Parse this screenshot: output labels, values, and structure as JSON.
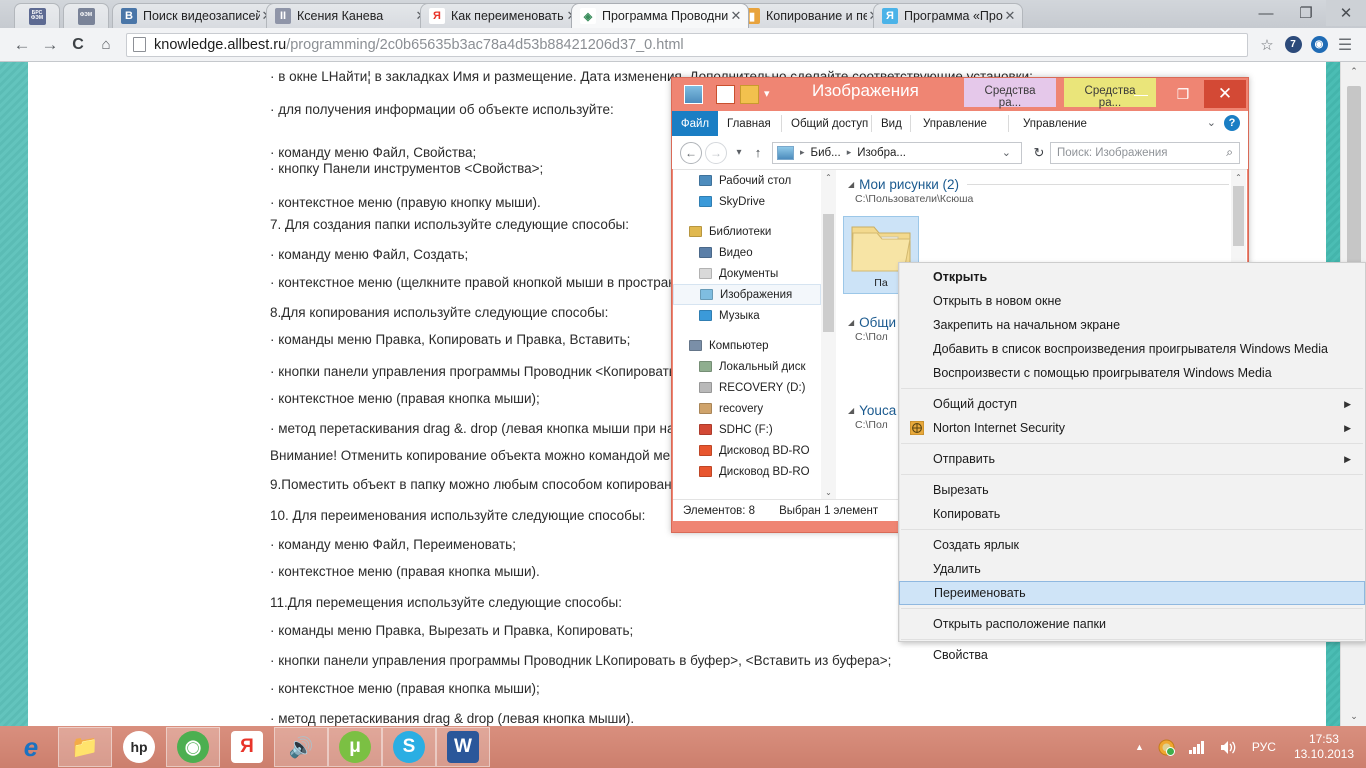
{
  "browser": {
    "pinned_tabs": [
      {
        "name": "pinned-tab-brs",
        "label": "БРС ФЭМ",
        "color": "#5d6a92"
      },
      {
        "name": "pinned-tab-fem",
        "label": "ФЭМ",
        "color": "#7a8398"
      }
    ],
    "tabs": [
      {
        "title": "Поиск видеозаписей по",
        "favicon": "vk-icon",
        "fav_letter": "B",
        "fav_color": "#4a76a8",
        "active": false,
        "close": "✕"
      },
      {
        "title": "Ксения Канева",
        "favicon": "vk-messages-icon",
        "fav_letter": "II",
        "fav_color": "#8f95a8",
        "active": false,
        "close": "✕"
      },
      {
        "title": "Как переименовать объ",
        "favicon": "yandex-icon",
        "fav_letter": "Я",
        "fav_color": "#ffffff",
        "active": false,
        "close": "✕"
      },
      {
        "title": "Программа Проводник",
        "favicon": "allbest-icon",
        "fav_letter": "◈",
        "fav_color": "#ffffff",
        "active": true,
        "close": "✕"
      },
      {
        "title": "Копирование и переме",
        "favicon": "doc-icon",
        "fav_letter": "▮",
        "fav_color": "#e8a33d",
        "active": false,
        "close": "✕"
      },
      {
        "title": "Программа «Проводни",
        "favicon": "yandex-blue-icon",
        "fav_letter": "Я",
        "fav_color": "#4bb3e8",
        "active": false,
        "close": "✕"
      }
    ],
    "window_buttons": {
      "minimize": "—",
      "maximize": "❐",
      "close": "✕"
    },
    "toolbar": {
      "back": "←",
      "forward": "→",
      "reload": "C",
      "home": "⌂",
      "url_host": "knowledge.allbest.ru",
      "url_path": "/programming/2c0b65635b3ac78a4d53b88421206d37_0.html",
      "bookmark": "☆",
      "ext1_label": "7",
      "ext2_label": "◉",
      "menu": "☰"
    }
  },
  "document": {
    "lines": [
      "· в окне LНайти¦ в закладках Имя и размещение. Дата изменения. Дополнительно сделайте соответствующие установки;",
      "· для получения информации об объекте используйте:",
      "· команду меню Файл, Свойства;",
      "· кнопку Панели инструментов <Свойства>;",
      "· контекстное меню (правую кнопку мыши).",
      "7. Для создания папки используйте следующие способы:",
      "· команду меню Файл, Создать;",
      "· контекстное меню (щелкните правой кнопкой мыши в пространстве",
      "8.Для копирования используйте следующие способы:",
      "· команды меню Правка, Копировать и Правка, Вставить;",
      "· кнопки панели управления программы Проводник <Копировать",
      "· контекстное меню (правая кнопка мыши);",
      "· метод перетаскивания drag &. drop (левая кнопка мыши при наж",
      "Внимание! Отменить копирование объекта можно командой мен",
      "9.Поместить объект в папку можно любым способом копировани",
      "10. Для переименования используйте следующие способы:",
      "· команду меню Файл, Переименовать;",
      "· контекстное меню (правая кнопка мыши).",
      "11.Для перемещения используйте следующие способы:",
      "· команды меню Правка, Вырезать и Правка, Копировать;",
      "· кнопки панели управления программы Проводник LКопировать в буфер>, <Вставить из буфера>;",
      "· контекстное меню (правая кнопка мыши);",
      "· метод перетаскивания drag & drop (левая кнопка мыши)."
    ]
  },
  "explorer": {
    "title": "Изображения",
    "quick_access": [
      "pictures-icon",
      "new-folder-icon",
      "properties-icon",
      "dropdown-arrow"
    ],
    "contextual_tabs": [
      {
        "label": "Средства ра...",
        "color": "#e5c8ea"
      },
      {
        "label": "Средства ра...",
        "color": "#eae57a"
      }
    ],
    "window_buttons": {
      "minimize": "—",
      "maximize": "❐",
      "close": "✕"
    },
    "ribbon_tabs": [
      "Файл",
      "Главная",
      "Общий доступ",
      "Вид",
      "Управление",
      "Управление"
    ],
    "ribbon_right": {
      "collapse": "⌄",
      "help": "?"
    },
    "address": {
      "back": "←",
      "forward": "→",
      "recent": "▾",
      "up": "↑",
      "crumbs": [
        "Биб...",
        "Изобра..."
      ],
      "dropdown": "⌄",
      "refresh": "↻",
      "search_placeholder": "Поиск: Изображения",
      "search_icon": "search-icon"
    },
    "nav_pane": [
      {
        "label": "Рабочий стол",
        "icon": "desktop-icon",
        "indent": true,
        "selected": false
      },
      {
        "label": "SkyDrive",
        "icon": "cloud-icon",
        "indent": true,
        "selected": false
      },
      {
        "gap": true
      },
      {
        "label": "Библиотеки",
        "icon": "libraries-icon",
        "indent": false,
        "selected": false
      },
      {
        "label": "Видео",
        "icon": "video-icon",
        "indent": true,
        "selected": false
      },
      {
        "label": "Документы",
        "icon": "documents-icon",
        "indent": true,
        "selected": false
      },
      {
        "label": "Изображения",
        "icon": "pictures-icon",
        "indent": true,
        "selected": true
      },
      {
        "label": "Музыка",
        "icon": "music-icon",
        "indent": true,
        "selected": false
      },
      {
        "gap": true
      },
      {
        "label": "Компьютер",
        "icon": "computer-icon",
        "indent": false,
        "selected": false
      },
      {
        "label": "Локальный диск",
        "icon": "hdd-icon",
        "indent": true,
        "selected": false
      },
      {
        "label": "RECOVERY (D:)",
        "icon": "drive-icon",
        "indent": true,
        "selected": false
      },
      {
        "label": "recovery",
        "icon": "recovery-icon",
        "indent": true,
        "selected": false
      },
      {
        "label": "SDHC (F:)",
        "icon": "sd-card-icon",
        "indent": true,
        "selected": false
      },
      {
        "label": "Дисковод BD-RO",
        "icon": "optical-drive-icon",
        "indent": true,
        "selected": false
      },
      {
        "label": "Дисковод BD-RO",
        "icon": "optical-drive-icon",
        "indent": true,
        "selected": false
      }
    ],
    "groups": [
      {
        "name": "Мои рисунки (2)",
        "path": "C:\\Пользователи\\Ксюша"
      },
      {
        "name": "Общи",
        "path": "C:\\Пол"
      },
      {
        "name": "Youca",
        "path": "C:\\Пол"
      }
    ],
    "selected_item": {
      "name": "Па",
      "icon": "folder-icon"
    },
    "status": {
      "count": "Элементов: 8",
      "selected": "Выбран 1 элемент"
    }
  },
  "context_menu": {
    "items": [
      {
        "label": "Открыть",
        "bold": true,
        "submenu": false,
        "icon": null,
        "highlighted": false
      },
      {
        "label": "Открыть в новом окне",
        "bold": false,
        "submenu": false,
        "icon": null,
        "highlighted": false
      },
      {
        "label": "Закрепить на начальном экране",
        "bold": false,
        "submenu": false,
        "icon": null,
        "highlighted": false
      },
      {
        "label": "Добавить в список воспроизведения проигрывателя Windows Media",
        "bold": false,
        "submenu": false,
        "icon": null,
        "highlighted": false
      },
      {
        "label": "Воспроизвести с помощью проигрывателя Windows Media",
        "bold": false,
        "submenu": false,
        "icon": null,
        "highlighted": false
      },
      {
        "separator": true
      },
      {
        "label": "Общий доступ",
        "bold": false,
        "submenu": true,
        "icon": null,
        "highlighted": false
      },
      {
        "label": "Norton Internet Security",
        "bold": false,
        "submenu": true,
        "icon": "norton-icon",
        "highlighted": false
      },
      {
        "separator": true
      },
      {
        "label": "Отправить",
        "bold": false,
        "submenu": true,
        "icon": null,
        "highlighted": false
      },
      {
        "separator": true
      },
      {
        "label": "Вырезать",
        "bold": false,
        "submenu": false,
        "icon": null,
        "highlighted": false
      },
      {
        "label": "Копировать",
        "bold": false,
        "submenu": false,
        "icon": null,
        "highlighted": false
      },
      {
        "separator": true
      },
      {
        "label": "Создать ярлык",
        "bold": false,
        "submenu": false,
        "icon": null,
        "highlighted": false
      },
      {
        "label": "Удалить",
        "bold": false,
        "submenu": false,
        "icon": null,
        "highlighted": false
      },
      {
        "label": "Переименовать",
        "bold": false,
        "submenu": false,
        "icon": null,
        "highlighted": true
      },
      {
        "separator": true
      },
      {
        "label": "Открыть расположение папки",
        "bold": false,
        "submenu": false,
        "icon": null,
        "highlighted": false
      },
      {
        "separator": true
      },
      {
        "label": "Свойства",
        "bold": false,
        "submenu": false,
        "icon": null,
        "highlighted": false
      }
    ],
    "submenu_arrow": "▶"
  },
  "taskbar": {
    "items": [
      {
        "name": "internet-explorer-icon",
        "label": "e",
        "color": "#1b72c1",
        "active": false
      },
      {
        "name": "file-explorer-icon",
        "label": "📁",
        "color": "#f2c14e",
        "active": true
      },
      {
        "name": "hp-icon",
        "label": "hp",
        "color": "#ffffff",
        "active": false
      },
      {
        "name": "chrome-icon",
        "label": "◉",
        "color": "#4caf50",
        "active": true
      },
      {
        "name": "yandex-browser-icon",
        "label": "Я",
        "color": "#e8342a",
        "active": false
      },
      {
        "name": "volume-app-icon",
        "label": "🔊",
        "color": "#2a7fc4",
        "active": true
      },
      {
        "name": "utorrent-icon",
        "label": "μ",
        "color": "#7bc043",
        "active": true
      },
      {
        "name": "skype-icon",
        "label": "S",
        "color": "#2aaee3",
        "active": true
      },
      {
        "name": "word-icon",
        "label": "W",
        "color": "#2b579a",
        "active": true
      }
    ],
    "tray": {
      "show_hidden": "▲",
      "norton": "norton-tray-icon",
      "network": "network-icon",
      "volume": "volume-icon",
      "language": "РУС",
      "time": "17:53",
      "date": "13.10.2013"
    }
  }
}
